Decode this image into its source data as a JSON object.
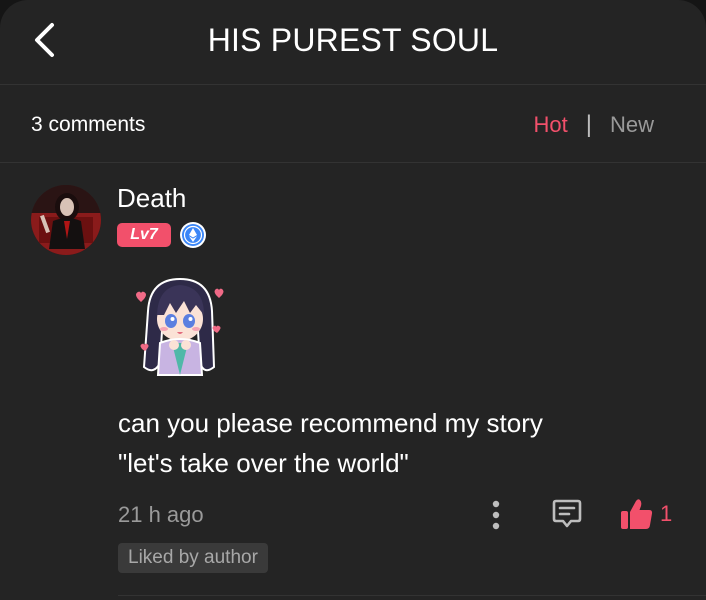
{
  "header": {
    "title": "HIS PUREST SOUL",
    "back_icon": "chevron-left-icon"
  },
  "comments_bar": {
    "count_label": "3 comments",
    "sort_options": [
      "Hot",
      "New"
    ],
    "separator": "|",
    "active_sort": "Hot"
  },
  "comment": {
    "username": "Death",
    "level_badge": "Lv7",
    "verified_icon": "verified-badge-icon",
    "sticker": "anime-girl-sticker",
    "text": "can you please recommend my story\n\"let's take over the world\"",
    "timestamp": "21 h ago",
    "like_count": "1",
    "liked_by_author_label": "Liked by author",
    "actions": {
      "more_icon": "more-vertical-icon",
      "reply_icon": "comment-icon",
      "like_icon": "thumbs-up-icon"
    }
  },
  "colors": {
    "background": "#242424",
    "accent": "#f2506b",
    "muted_text": "#9a9a9a",
    "badge_blue": "#3b86f7"
  }
}
